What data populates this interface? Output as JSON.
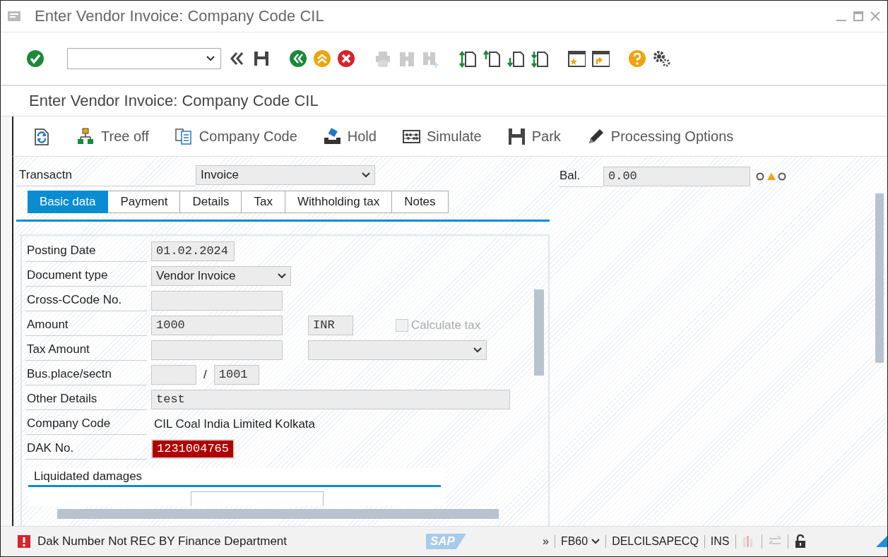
{
  "window": {
    "title": "Enter Vendor Invoice: Company Code CIL"
  },
  "toolbar": [
    {
      "kind": "enter",
      "disabled": false
    },
    {
      "kind": "command",
      "disabled": false
    },
    {
      "kind": "collapse",
      "disabled": false
    },
    {
      "kind": "save",
      "disabled": false
    },
    {
      "kind": "back",
      "disabled": false
    },
    {
      "kind": "exit",
      "disabled": false
    },
    {
      "kind": "cancel",
      "disabled": false
    },
    {
      "kind": "print",
      "disabled": true
    },
    {
      "kind": "find",
      "disabled": true
    },
    {
      "kind": "find-next",
      "disabled": true
    },
    {
      "kind": "first-page",
      "disabled": false
    },
    {
      "kind": "previous-page",
      "disabled": false
    },
    {
      "kind": "next-page",
      "disabled": false
    },
    {
      "kind": "last-page",
      "disabled": false
    },
    {
      "kind": "new-session",
      "disabled": false
    },
    {
      "kind": "shortcut",
      "disabled": false
    },
    {
      "kind": "help",
      "disabled": false
    },
    {
      "kind": "settings",
      "disabled": false
    }
  ],
  "screen_title": "Enter Vendor Invoice: Company Code CIL",
  "app_toolbar": [
    {
      "kind": "refresh"
    },
    {
      "kind": "tree",
      "label": "Tree off"
    },
    {
      "kind": "company",
      "label": "Company Code"
    },
    {
      "kind": "hold",
      "label": "Hold"
    },
    {
      "kind": "simulate",
      "label": "Simulate"
    },
    {
      "kind": "save",
      "label": "Park"
    },
    {
      "kind": "edit",
      "label": "Processing Options"
    }
  ],
  "transaction": {
    "label": "Transactn",
    "value": "Invoice"
  },
  "balance": {
    "label": "Bal.",
    "value": "0.00"
  },
  "tabs": [
    {
      "label": "Basic data",
      "selected": true
    },
    {
      "label": "Payment",
      "selected": false
    },
    {
      "label": "Details",
      "selected": false
    },
    {
      "label": "Tax",
      "selected": false
    },
    {
      "label": "Withholding tax",
      "selected": false
    },
    {
      "label": "Notes",
      "selected": false
    }
  ],
  "form": {
    "rows": [
      {
        "label": "Posting Date",
        "fields": [
          {
            "kind": "date",
            "value": "01.02.2024"
          }
        ]
      },
      {
        "label": "Document type",
        "fields": [
          {
            "kind": "dropdown",
            "value": "Vendor Invoice"
          }
        ]
      },
      {
        "label": "Cross-CCode No.",
        "fields": [
          {
            "kind": "medium"
          }
        ]
      },
      {
        "label": "Amount",
        "fields": [
          {
            "kind": "medium",
            "value": "1000"
          },
          {
            "kind": "currency",
            "value": "INR"
          },
          {
            "kind": "checkbox",
            "label": "Calculate tax",
            "checked": false,
            "disabled": true
          }
        ]
      },
      {
        "label": "Tax Amount",
        "fields": [
          {
            "kind": "medium"
          },
          {
            "kind": "select"
          }
        ]
      },
      {
        "label": "Bus.place/sectn",
        "fields": [
          {
            "kind": "short"
          },
          {
            "kind": "separator",
            "text": "/"
          },
          {
            "kind": "short",
            "value": "1001"
          }
        ]
      },
      {
        "label": "Other Details",
        "fields": [
          {
            "kind": "wide",
            "value": "test"
          }
        ]
      },
      {
        "label": "Company Code",
        "fields": [
          {
            "kind": "display",
            "value": "CIL Coal India Limited Kolkata"
          }
        ]
      },
      {
        "label": "DAK No.",
        "fields": [
          {
            "kind": "date",
            "value": "1231004765",
            "error": true
          }
        ]
      }
    ]
  },
  "subsection": {
    "title": "Liquidated damages"
  },
  "status_bar": {
    "message": {
      "kind": "error",
      "text": "Dak Number Not REC BY Finance Department"
    },
    "logo": "SAP",
    "items": [
      {
        "kind": "text",
        "text": "»"
      },
      {
        "kind": "dropdown",
        "text": "FB60"
      },
      {
        "kind": "text",
        "text": "DELCILSAPECQ"
      },
      {
        "kind": "text",
        "text": "INS"
      },
      {
        "kind": "chart"
      },
      {
        "kind": "arrows"
      },
      {
        "kind": "lock"
      }
    ]
  }
}
